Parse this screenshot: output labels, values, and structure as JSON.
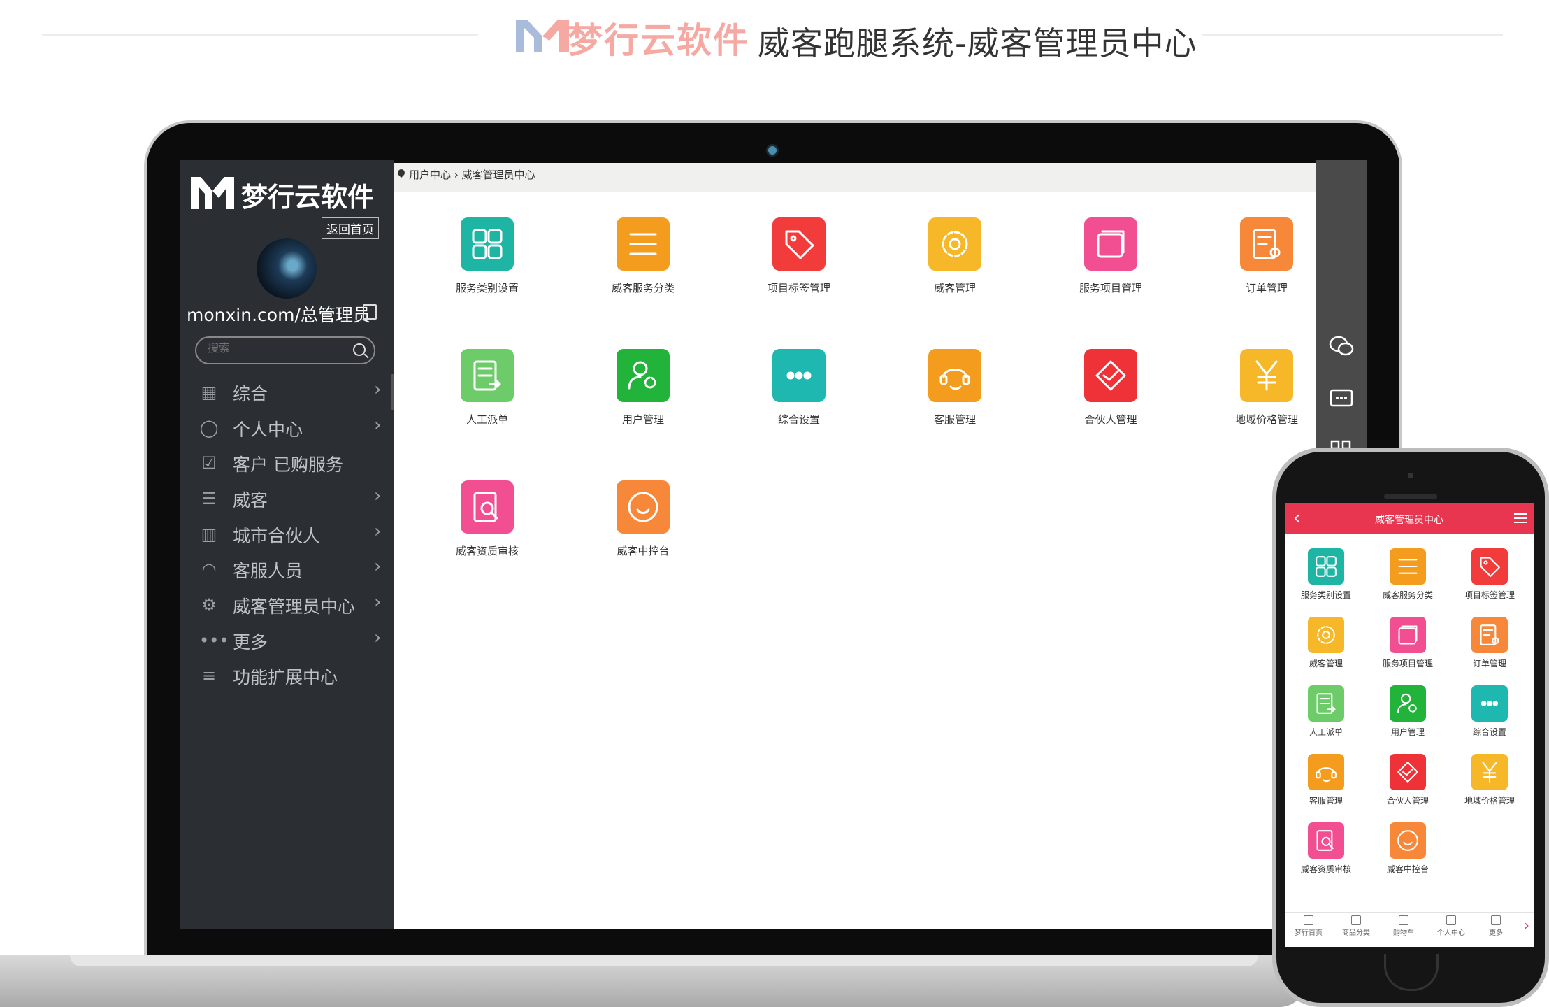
{
  "banner": {
    "brand_name": "梦行云软件",
    "title": "威客跑腿系统-威客管理员中心"
  },
  "sidebar": {
    "brand_name": "梦行云软件",
    "home_button": "返回首页",
    "user": "monxin.com/总管理员",
    "search_placeholder": "搜索",
    "items": [
      {
        "label": "综合",
        "icon": "grid-icon",
        "chevron": "›"
      },
      {
        "label": "个人中心",
        "icon": "user-icon",
        "chevron": "›"
      },
      {
        "label": "客户 已购服务",
        "icon": "bag-icon",
        "chevron": ""
      },
      {
        "label": "威客",
        "icon": "layers-icon",
        "chevron": "›"
      },
      {
        "label": "城市合伙人",
        "icon": "building-icon",
        "chevron": "›"
      },
      {
        "label": "客服人员",
        "icon": "headset-icon",
        "chevron": "›"
      },
      {
        "label": "威客管理员中心",
        "icon": "user-gear-icon",
        "chevron": "›"
      },
      {
        "label": "更多",
        "icon": "more-icon",
        "chevron": "›"
      },
      {
        "label": "功能扩展中心",
        "icon": "menu-icon",
        "chevron": ""
      }
    ]
  },
  "breadcrumb": "用户中心 › 威客管理员中心",
  "apps": [
    {
      "label": "服务类别设置",
      "icon": "grid-icon",
      "color": "#1fb5a5"
    },
    {
      "label": "威客服务分类",
      "icon": "list-icon",
      "color": "#f39c1e"
    },
    {
      "label": "项目标签管理",
      "icon": "tag-icon",
      "color": "#f23b3b"
    },
    {
      "label": "威客管理",
      "icon": "gear-icon",
      "color": "#f6b829"
    },
    {
      "label": "服务项目管理",
      "icon": "cards-icon",
      "color": "#f14f92"
    },
    {
      "label": "订单管理",
      "icon": "order-icon",
      "color": "#f7883a"
    },
    {
      "label": "人工派单",
      "icon": "dispatch-icon",
      "color": "#6dcb6a"
    },
    {
      "label": "用户管理",
      "icon": "user-gear-icon",
      "color": "#22b33b"
    },
    {
      "label": "综合设置",
      "icon": "dots-icon",
      "color": "#1fb8b1"
    },
    {
      "label": "客服管理",
      "icon": "headset-icon",
      "color": "#f39c1e"
    },
    {
      "label": "合伙人管理",
      "icon": "handshake-icon",
      "color": "#ef3138"
    },
    {
      "label": "地域价格管理",
      "icon": "yen-icon",
      "color": "#f6b829"
    },
    {
      "label": "威客资质审核",
      "icon": "audit-icon",
      "color": "#f14f92"
    },
    {
      "label": "威客中控台",
      "icon": "smile-icon",
      "color": "#f7883a"
    }
  ],
  "phone": {
    "title": "威客管理员中心",
    "back": "‹",
    "tabs": [
      "梦行首页",
      "商品分类",
      "购物车",
      "个人中心",
      "更多"
    ],
    "tab_arrow": "›"
  }
}
